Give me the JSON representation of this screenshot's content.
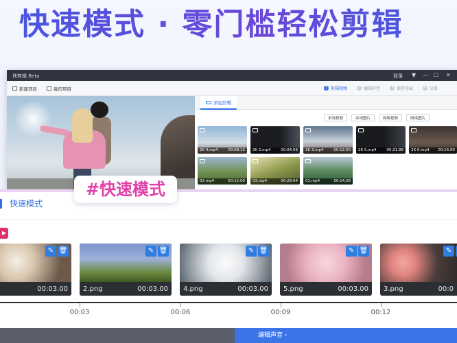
{
  "headline": "快速模式 · 零门槛轻松剪辑",
  "window": {
    "app_title": "快剪辑 Beta",
    "login_label": "登录",
    "controls": {
      "menu": "▼",
      "minimize": "—",
      "maximize": "☐",
      "close": "✕"
    },
    "toolbar": {
      "new_project": "新建项目",
      "my_projects": "我的项目"
    },
    "steps": [
      {
        "num": "1",
        "label": "剪辑视频"
      },
      {
        "num": "2",
        "label": "编辑声音"
      },
      {
        "num": "3",
        "label": "保存导出"
      },
      {
        "num": "4",
        "label": "分享"
      }
    ],
    "media_tab": "添加剪辑",
    "source_buttons": [
      "本地视频",
      "本地图片",
      "网络视频",
      "网络图片"
    ],
    "media": [
      {
        "name": "2K 4.mp4",
        "duration": "00:08.12"
      },
      {
        "name": "2K 2.mp4",
        "duration": "00:04:56"
      },
      {
        "name": "2K 3.mp4",
        "duration": "00:12:50"
      },
      {
        "name": "2K 5.mp4",
        "duration": "00:21.88"
      },
      {
        "name": "2K 6.mp4",
        "duration": "00:16.89"
      },
      {
        "name": "02.mp4",
        "duration": "00:12:00"
      },
      {
        "name": "03.mp4",
        "duration": "00:28.64"
      },
      {
        "name": "01.mp4",
        "duration": "00:14.28"
      }
    ]
  },
  "hashtag": "#快速模式",
  "editor": {
    "mode_title": "快速模式",
    "play_icon": "▶",
    "clips": [
      {
        "name": "",
        "duration": "00:03.00"
      },
      {
        "name": "2.png",
        "duration": "00:03.00"
      },
      {
        "name": "4.png",
        "duration": "00:03.00"
      },
      {
        "name": "5.png",
        "duration": "00:03.00"
      },
      {
        "name": "3.png",
        "duration": "00:0"
      }
    ],
    "timeline": [
      "00:03",
      "00:06",
      "00:09",
      "00:12"
    ],
    "next_button": "编辑声音 ›"
  },
  "icons": {
    "edit": "✎",
    "delete": "🗑"
  }
}
